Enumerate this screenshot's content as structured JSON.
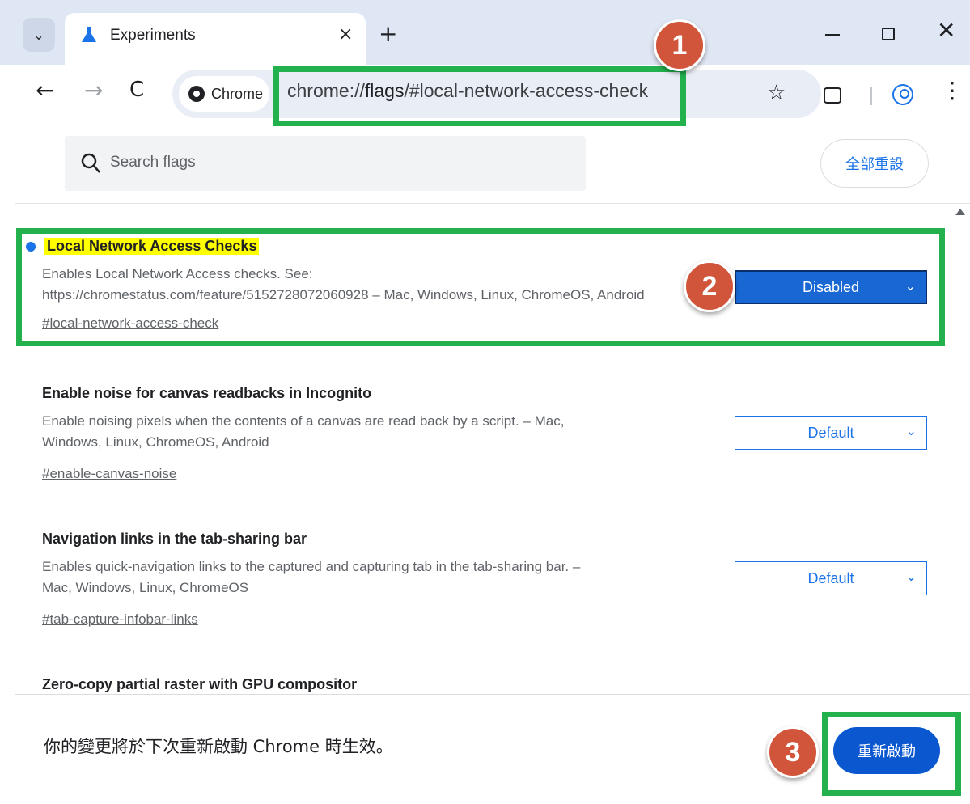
{
  "tab": {
    "title": "Experiments",
    "close": "×",
    "new_tab": "+"
  },
  "window": {
    "search_tabs": "⌄",
    "close": "✕"
  },
  "toolbar": {
    "back": "←",
    "forward": "→",
    "reload": "C",
    "chip_label": "Chrome",
    "url_prefix": "chrome://",
    "url_host": "flags",
    "url_suffix": "/#local-network-access-check",
    "star": "☆",
    "menu": "⋮"
  },
  "header": {
    "search_placeholder": "Search flags",
    "reset_all": "全部重設"
  },
  "flags": [
    {
      "title": "Local Network Access Checks",
      "description": "Enables Local Network Access checks. See:\nhttps://chromestatus.com/feature/5152728072060928 – Mac, Windows, Linux, ChromeOS, Android",
      "anchor": "#local-network-access-check",
      "value": "Disabled",
      "modified": true
    },
    {
      "title": "Enable noise for canvas readbacks in Incognito",
      "description": "Enable noising pixels when the contents of a canvas are read back by a script. – Mac,\nWindows, Linux, ChromeOS, Android",
      "anchor": "#enable-canvas-noise",
      "value": "Default",
      "modified": false
    },
    {
      "title": "Navigation links in the tab-sharing bar",
      "description": "Enables quick-navigation links to the captured and capturing tab in the tab-sharing bar. –\nMac, Windows, Linux, ChromeOS",
      "anchor": "#tab-capture-infobar-links",
      "value": "Default",
      "modified": false
    },
    {
      "title": "Zero-copy partial raster with GPU compositor"
    }
  ],
  "bottom_bar": {
    "message": "你的變更將於下次重新啟動 Chrome 時生效。",
    "relaunch": "重新啟動"
  },
  "annotations": {
    "step1": "1",
    "step2": "2",
    "step3": "3",
    "box_color": "#22b14c",
    "badge_color": "#d1553a"
  },
  "colors": {
    "accent": "#1a73e8",
    "highlight": "#ffff00"
  }
}
